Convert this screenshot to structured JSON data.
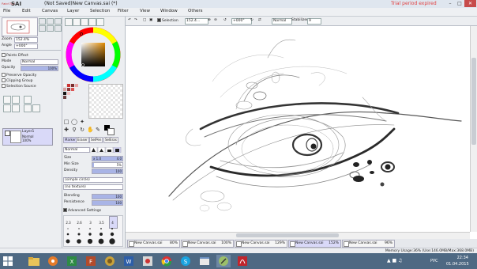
{
  "window": {
    "app_short": "Paint Tool",
    "app_name": "SAI",
    "title": "(Not Saved)New Canvas.sai (*)",
    "trial": "Trial period expired"
  },
  "menu": [
    "File",
    "Edit",
    "Canvas",
    "Layer",
    "Selection",
    "Filter",
    "View",
    "Window",
    "Others"
  ],
  "navigator": {
    "zoom_label": "Zoom",
    "zoom_value": "152.4%",
    "angle_label": "Angle",
    "angle_value": "+000°"
  },
  "layer_props": {
    "paints_effect": "Paints Effect",
    "mode_label": "Mode",
    "mode_value": "Normal",
    "opacity_label": "Opacity",
    "opacity_value": "100%",
    "preserve_opacity": "Preserve Opacity",
    "clipping_group": "Clipping Group",
    "selection_source": "Selection Source"
  },
  "layer": {
    "name": "Layer1",
    "mode": "Normal",
    "opacity": "100%"
  },
  "tool_tabs": [
    "Marker",
    "Eraser",
    "SelPen",
    "SelEras"
  ],
  "brush": {
    "mode": "Normal",
    "size_label": "Size",
    "size_mult": "x 1.0",
    "size_value": "4.0",
    "min_size_label": "Min Size",
    "min_size_value": "5%",
    "min_size_level": 0.05,
    "density_label": "Density",
    "density_value": "100",
    "density_level": 1.0,
    "shape": "(simple circle)",
    "texture": "(no texture)",
    "blending_label": "Blending",
    "blending_value": "100",
    "blending_level": 1.0,
    "persistence_label": "Persistence",
    "persistence_value": "100",
    "persistence_level": 1.0,
    "advanced": "Advanced Settings",
    "sizes": [
      "2.3",
      "2.6",
      "3",
      "3.5",
      "4"
    ]
  },
  "toolbar": {
    "selection_label": "Selection",
    "zoom_value": "152.4...",
    "angle_value": "+000°",
    "mode_value": "Normal",
    "stabilizer_label": "Stabilizer",
    "stabilizer_value": "9"
  },
  "doc_tabs": [
    {
      "name": "New Canvas.sai",
      "pct": "80%"
    },
    {
      "name": "New Canvas.sai",
      "pct": "100%"
    },
    {
      "name": "New Canvas.sai",
      "pct": "129%"
    },
    {
      "name": "New Canvas.sai",
      "pct": "152%"
    },
    {
      "name": "New Canvas.sai",
      "pct": "96%"
    }
  ],
  "status": {
    "memory": "Memory Usage:36% (Use:146.0MB/Max:368.0MB)"
  },
  "taskbar": {
    "lang": "РУС",
    "time": "22:34",
    "date": "01.04.2015"
  },
  "colors": {
    "accent": "#d9d9f8",
    "trial": "#e04040",
    "taskbar": "#4e6983"
  }
}
